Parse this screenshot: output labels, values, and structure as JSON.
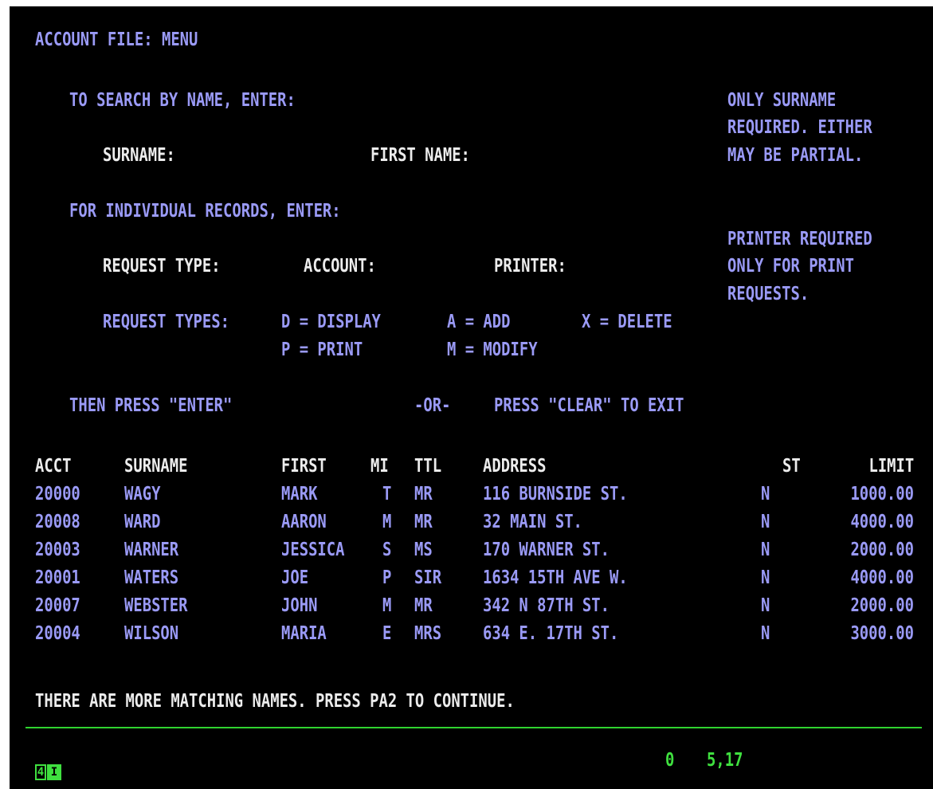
{
  "screen": {
    "title": "ACCOUNT FILE: MENU",
    "search_prompt": "TO SEARCH BY NAME, ENTER:",
    "surname_label": "SURNAME:",
    "surname_value": "",
    "first_name_label": "FIRST NAME:",
    "first_name_value": "",
    "search_note": [
      "ONLY SURNAME",
      "REQUIRED. EITHER",
      "MAY BE PARTIAL."
    ],
    "individual_prompt": "FOR INDIVIDUAL RECORDS, ENTER:",
    "request_type_label": "REQUEST TYPE:",
    "request_type_value": "",
    "account_label": "ACCOUNT:",
    "account_value": "",
    "printer_label": "PRINTER:",
    "printer_value": "",
    "printer_note": [
      "PRINTER REQUIRED",
      "ONLY FOR PRINT",
      "REQUESTS."
    ],
    "request_types_label": "REQUEST TYPES:",
    "request_types": {
      "display": "D = DISPLAY",
      "add": "A = ADD",
      "delete": "X = DELETE",
      "print": "P = PRINT",
      "modify": "M = MODIFY"
    },
    "then_press": "THEN PRESS \"ENTER\"",
    "or": "-OR-",
    "press_clear": "PRESS \"CLEAR\" TO EXIT"
  },
  "table": {
    "headers": {
      "acct": "ACCT",
      "surname": "SURNAME",
      "first": "FIRST",
      "mi": "MI",
      "ttl": "TTL",
      "address": "ADDRESS",
      "st": "ST",
      "limit": "LIMIT"
    },
    "rows": [
      {
        "acct": "20000",
        "surname": "WAGY",
        "first": "MARK",
        "mi": "T",
        "ttl": "MR",
        "address": "116 BURNSIDE ST.",
        "st": "N",
        "limit": "1000.00"
      },
      {
        "acct": "20008",
        "surname": "WARD",
        "first": "AARON",
        "mi": "M",
        "ttl": "MR",
        "address": "32 MAIN ST.",
        "st": "N",
        "limit": "4000.00"
      },
      {
        "acct": "20003",
        "surname": "WARNER",
        "first": "JESSICA",
        "mi": "S",
        "ttl": "MS",
        "address": "170 WARNER ST.",
        "st": "N",
        "limit": "2000.00"
      },
      {
        "acct": "20001",
        "surname": "WATERS",
        "first": "JOE",
        "mi": "P",
        "ttl": "SIR",
        "address": "1634 15TH AVE W.",
        "st": "N",
        "limit": "4000.00"
      },
      {
        "acct": "20007",
        "surname": "WEBSTER",
        "first": "JOHN",
        "mi": "M",
        "ttl": "MR",
        "address": "342 N 87TH ST.",
        "st": "N",
        "limit": "2000.00"
      },
      {
        "acct": "20004",
        "surname": "WILSON",
        "first": "MARIA",
        "mi": "E",
        "ttl": "MRS",
        "address": "634 E. 17TH ST.",
        "st": "N",
        "limit": "3000.00"
      }
    ]
  },
  "message": "THERE ARE MORE MATCHING NAMES. PRESS PA2 TO CONTINUE.",
  "status": {
    "badge_left": "4",
    "badge_right": "I",
    "indicator": "0",
    "cursor_position": "5,17"
  },
  "colors": {
    "background": "#000000",
    "field_text": "#9a9af6",
    "label_text": "#ececec",
    "status_green": "#3fe03f"
  }
}
